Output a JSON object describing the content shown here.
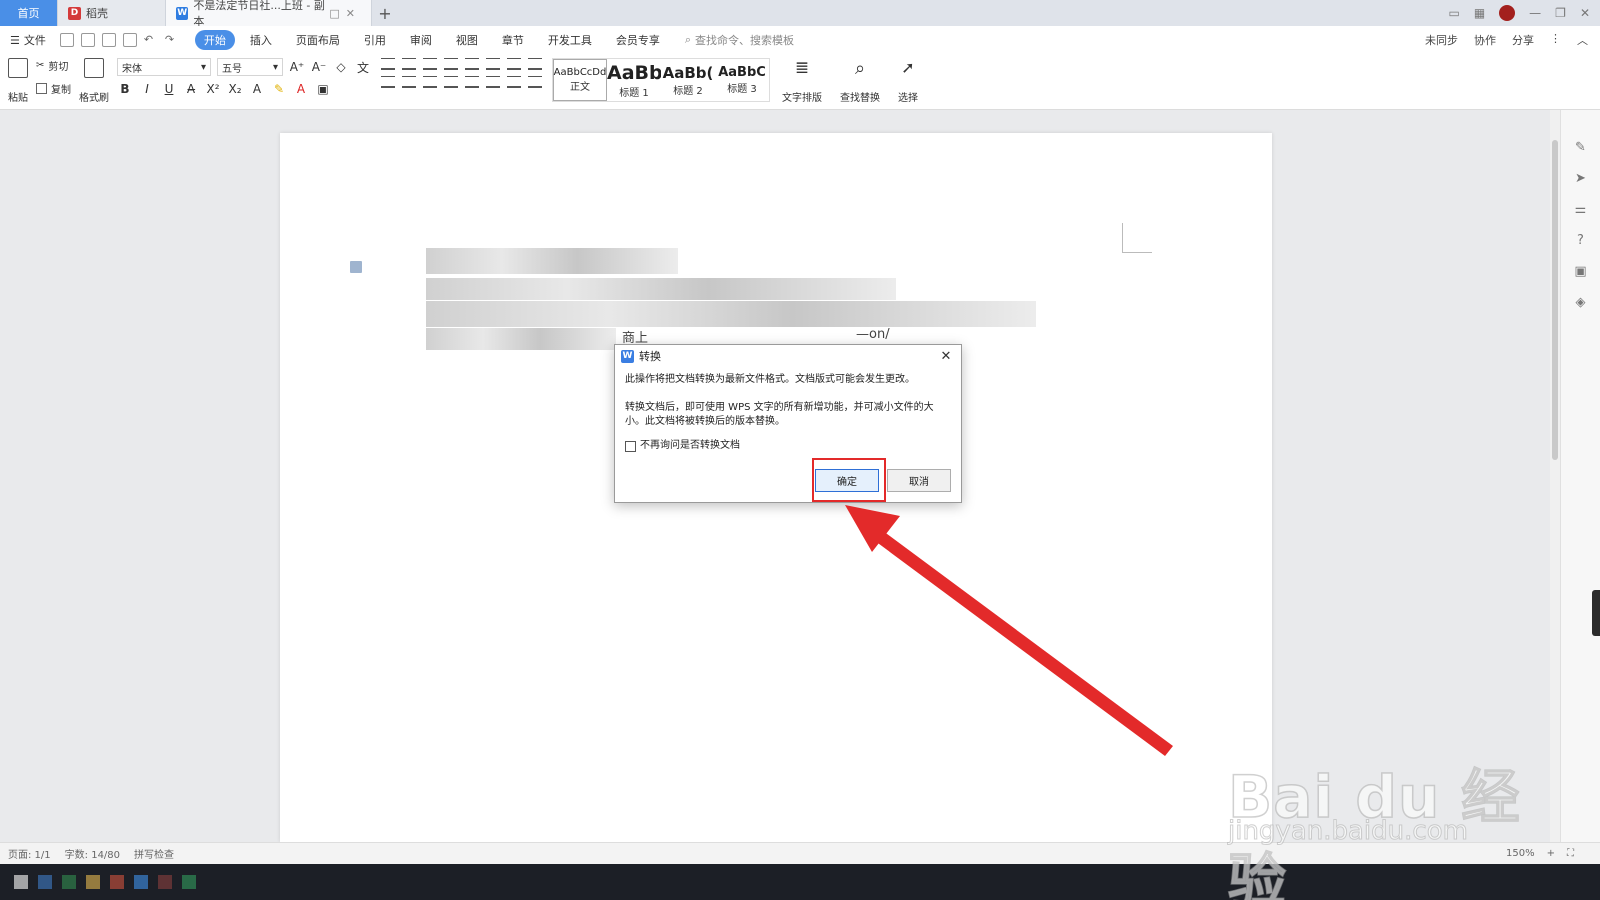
{
  "tabs": {
    "home": "首页",
    "daoke": "稻壳",
    "document": "不是法定节日社...上班 - 副本",
    "add": "+"
  },
  "menubar": {
    "file": "文件",
    "items": [
      "开始",
      "插入",
      "页面布局",
      "引用",
      "审阅",
      "视图",
      "章节",
      "开发工具",
      "会员专享"
    ],
    "active_index": 0,
    "search": "查找命令、搜索模板",
    "right": [
      "未同步",
      "协作",
      "分享"
    ]
  },
  "ribbon": {
    "paste": "粘贴",
    "cut": "剪切",
    "copy": "复制",
    "format_painter": "格式刷",
    "font_name": "宋体",
    "font_size": "五号",
    "styles": [
      {
        "preview": "AaBbCcDd",
        "label": "正文"
      },
      {
        "preview": "AaBb",
        "label": "标题 1"
      },
      {
        "preview": "AaBb(",
        "label": "标题 2"
      },
      {
        "preview": "AaBbC",
        "label": "标题 3"
      }
    ],
    "text_layout": "文字排版",
    "find_replace": "查找替换",
    "select": "选择"
  },
  "document": {
    "fragment_left": "商上",
    "fragment_right": "—on/"
  },
  "dialog": {
    "title": "转换",
    "message1": "此操作将把文档转换为最新文件格式。文档版式可能会发生更改。",
    "message2": "转换文档后，即可使用 WPS 文字的所有新增功能，并可减小文件的大小。此文档将被转换后的版本替换。",
    "checkbox_label": "不再询问是否转换文档",
    "checkbox_checked": false,
    "ok": "确定",
    "cancel": "取消",
    "close": "✕"
  },
  "statusbar": {
    "page": "页面: 1/1",
    "words": "字数: 14/80",
    "spell": "拼写检查",
    "zoom": "150%"
  },
  "watermark": {
    "brand": "Bai du 经验",
    "url": "jingyan.baidu.com"
  },
  "colors": {
    "accent": "#4a8fe7",
    "highlight_red": "#e32a2a"
  }
}
